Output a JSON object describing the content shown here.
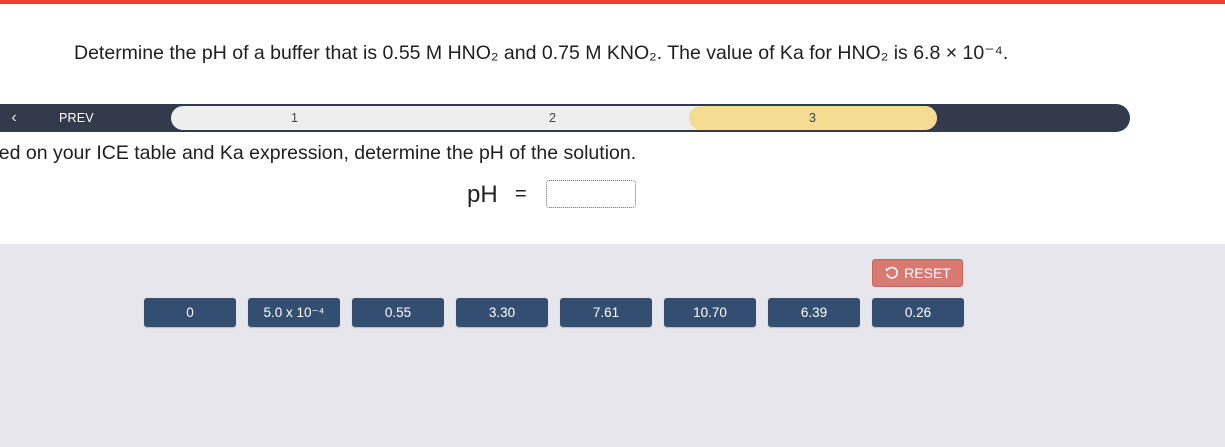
{
  "question": {
    "text": "Determine the pH of a buffer that is 0.55 M HNO₂ and 0.75 M KNO₂. The value of Ka for HNO₂ is 6.8 × 10⁻⁴."
  },
  "stepbar": {
    "back_icon": "chevron-left",
    "prev_label": "PREV",
    "steps": [
      "1",
      "2",
      "3"
    ],
    "active_step": "3",
    "active_color": "#f4dc93"
  },
  "instruction": "sed on your ICE table and Ka expression, determine the pH of the solution.",
  "answer": {
    "label": "pH",
    "equals": "=",
    "value": "",
    "placeholder": ""
  },
  "reset": {
    "label": "RESET",
    "icon": "undo-icon"
  },
  "tiles": [
    "0",
    "5.0 x 10⁻⁴",
    "0.55",
    "3.30",
    "7.61",
    "10.70",
    "6.39",
    "0.26"
  ],
  "colors": {
    "top_accent": "#e8412a",
    "stepbar": "#323a4b",
    "tile": "#344e71",
    "reset": "#d97a72",
    "tray": "#e7e6ed"
  }
}
